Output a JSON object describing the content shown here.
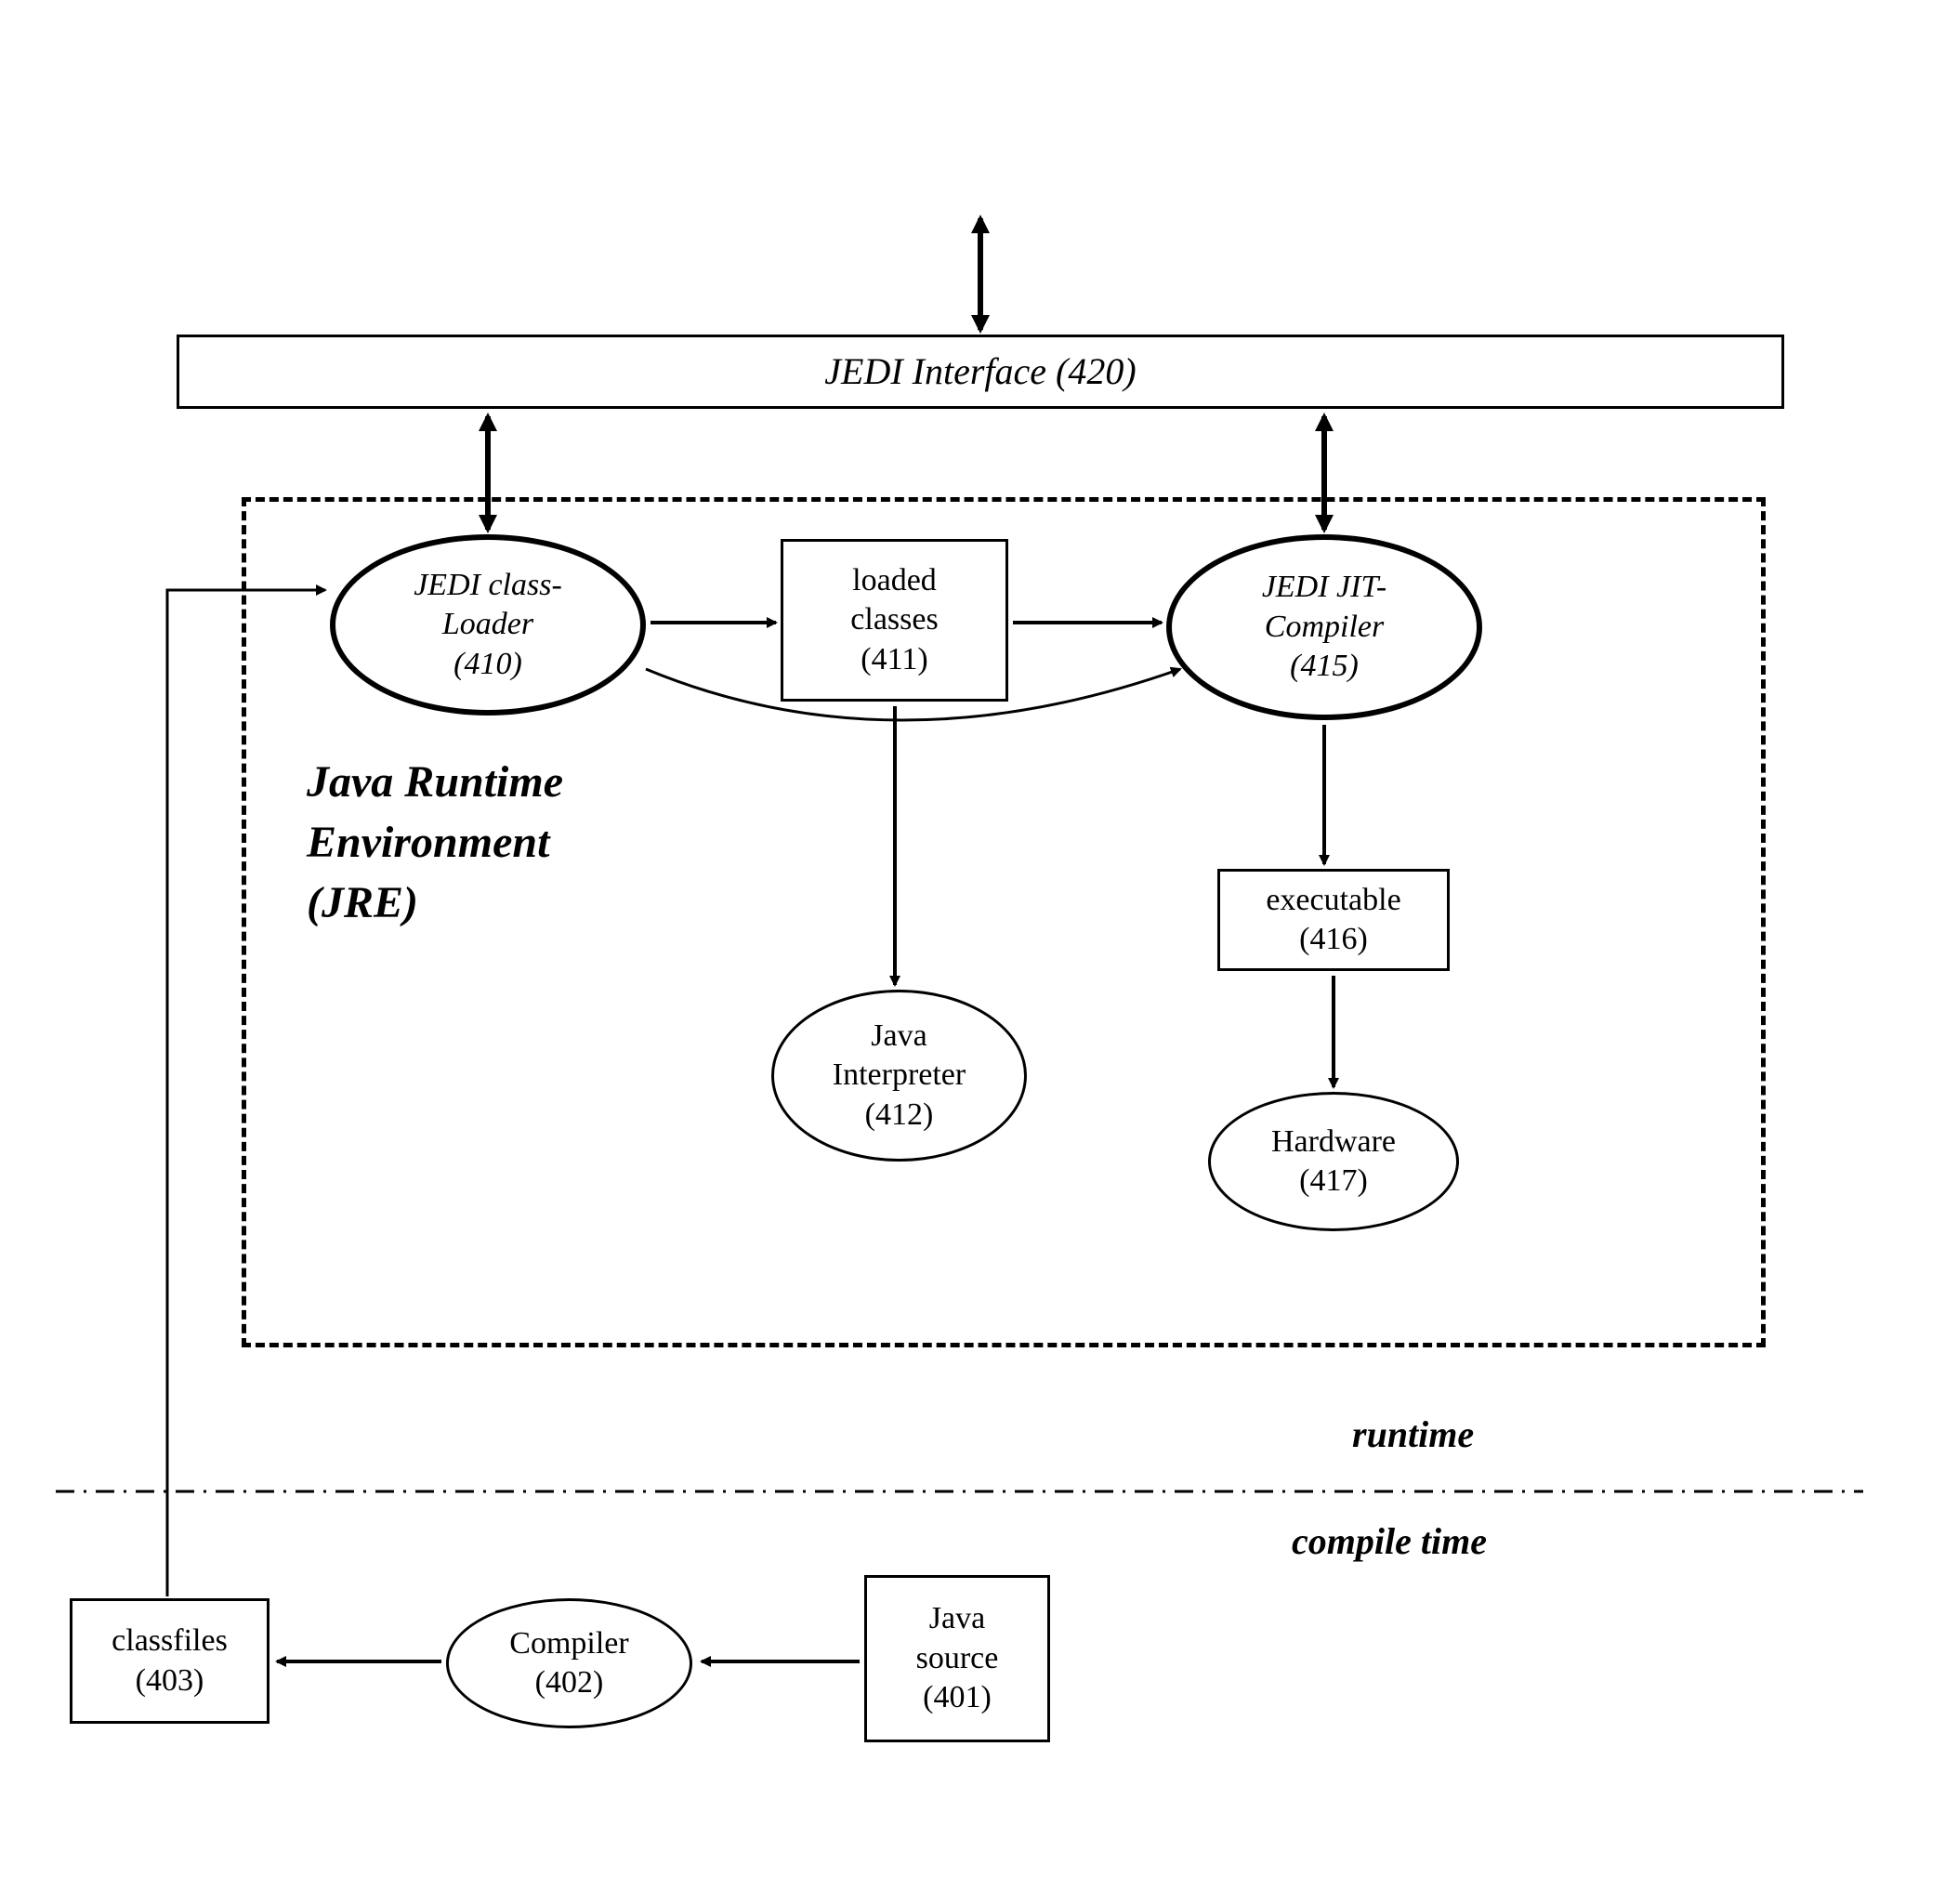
{
  "nodes": {
    "jedi_interface": "JEDI Interface (420)",
    "jedi_classloader": {
      "l1": "JEDI  class-",
      "l2": "Loader",
      "l3": "(410)"
    },
    "loaded_classes": {
      "l1": "loaded",
      "l2": "classes",
      "l3": "(411)"
    },
    "jedi_jit_compiler": {
      "l1": "JEDI JIT-",
      "l2": "Compiler",
      "l3": "(415)"
    },
    "java_interpreter": {
      "l1": "Java",
      "l2": "Interpreter",
      "l3": "(412)"
    },
    "executable": {
      "l1": "executable",
      "l2": "(416)"
    },
    "hardware": {
      "l1": "Hardware",
      "l2": "(417)"
    },
    "java_source": {
      "l1": "Java",
      "l2": "source",
      "l3": "(401)"
    },
    "compiler": {
      "l1": "Compiler",
      "l2": "(402)"
    },
    "classfiles": {
      "l1": "classfiles",
      "l2": "(403)"
    }
  },
  "labels": {
    "jre": {
      "l1": "Java Runtime",
      "l2": "Environment",
      "l3": "(JRE)"
    },
    "runtime": "runtime",
    "compile_time": "compile time"
  }
}
